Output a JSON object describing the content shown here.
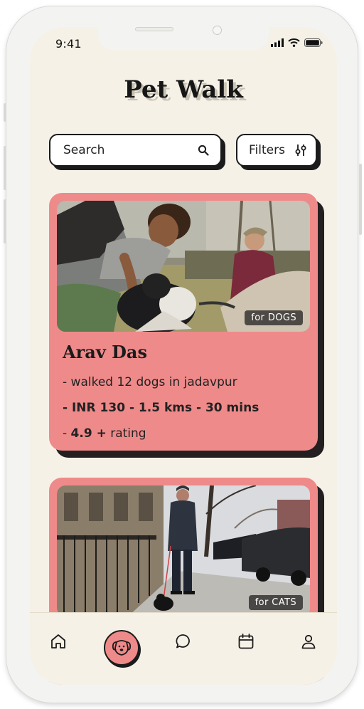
{
  "status_bar": {
    "time": "9:41"
  },
  "app": {
    "title": "Pet Walk"
  },
  "search": {
    "placeholder": "Search",
    "icon": "search-icon"
  },
  "filters": {
    "label": "Filters",
    "icon": "sliders-icon"
  },
  "walkers": [
    {
      "name": "Arav Das",
      "badge": "for DOGS",
      "details": [
        "- walked 12 dogs in jadavpur",
        "- INR 130 - 1.5 kms - 30 mins"
      ],
      "rating_prefix": "- ",
      "rating_value": "4.9 +",
      "rating_suffix": " rating"
    },
    {
      "badge": "for CATS"
    }
  ],
  "tab_bar": {
    "tabs": [
      {
        "icon": "home-icon"
      },
      {
        "icon": "dog-icon",
        "active": true
      },
      {
        "icon": "chat-icon"
      },
      {
        "icon": "calendar-icon"
      },
      {
        "icon": "profile-icon"
      }
    ]
  },
  "colors": {
    "background": "#f6f1e7",
    "card": "#ef8a8a",
    "ink": "#1b1b1b"
  }
}
